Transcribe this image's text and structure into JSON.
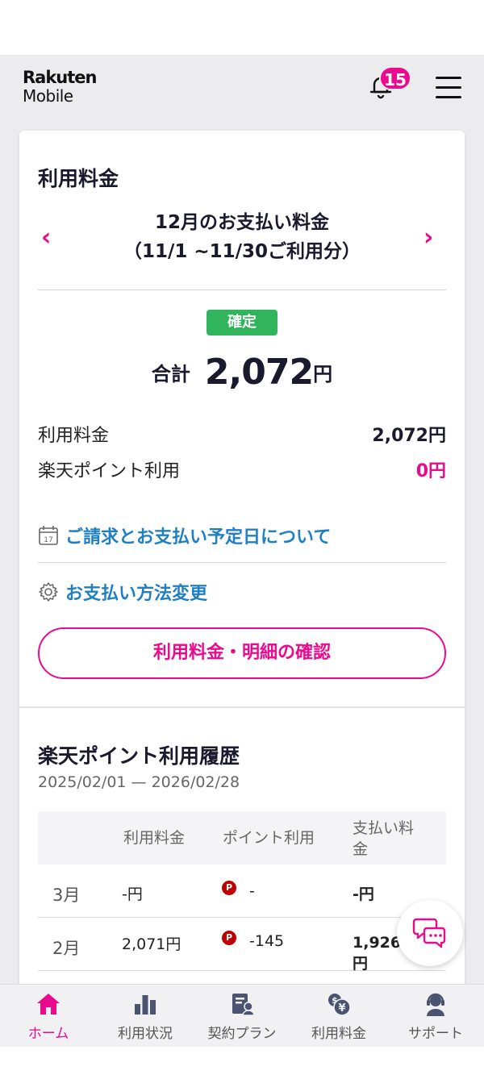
{
  "brand": {
    "logo_line1": "Rakuten",
    "logo_line2": "Mobile",
    "accent": "#ea0a8e"
  },
  "header": {
    "notification_count": "15"
  },
  "billing": {
    "title": "利用料金",
    "month_line1": "12月のお支払い料金",
    "month_line2": "（11/1 ~11/30ご利用分）",
    "status": "確定",
    "total_label": "合計",
    "total_amount": "2,072",
    "total_unit": "円",
    "usage_label": "利用料金",
    "usage_value": "2,072円",
    "points_label": "楽天ポイント利用",
    "points_value": "0円",
    "link_schedule": "ご請求とお支払い予定日について",
    "link_payment_method": "お支払い方法変更",
    "detail_button": "利用料金・明細の確認"
  },
  "points_history": {
    "title": "楽天ポイント利用履歴",
    "period": "2025/02/01 — 2026/02/28",
    "columns": [
      "利用料金",
      "ポイント利用",
      "支払い料",
      "金"
    ],
    "rows": [
      {
        "month": "3月",
        "usage": "-円",
        "points": "-",
        "payment_line1": "-円",
        "payment_line2": ""
      },
      {
        "month": "2月",
        "usage": "2,071円",
        "points": "-145",
        "payment_line1": "1,926",
        "payment_line2": "円"
      }
    ],
    "point_mark": "P"
  },
  "bottom_nav": [
    {
      "label": "ホーム",
      "icon": "home-icon",
      "active": true
    },
    {
      "label": "利用状況",
      "icon": "bar-chart-icon",
      "active": false
    },
    {
      "label": "契約プラン",
      "icon": "contract-icon",
      "active": false
    },
    {
      "label": "利用料金",
      "icon": "yen-coins-icon",
      "active": false
    },
    {
      "label": "サポート",
      "icon": "support-agent-icon",
      "active": false
    }
  ]
}
